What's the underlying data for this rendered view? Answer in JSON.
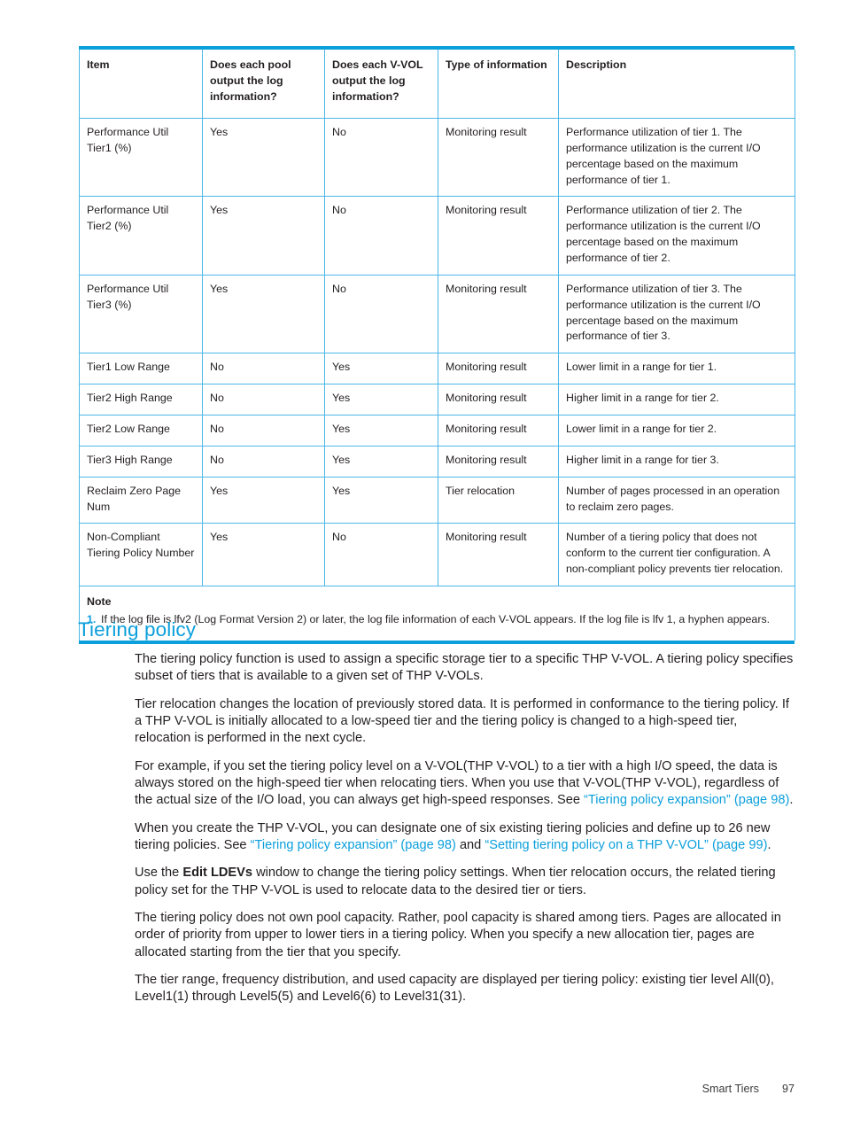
{
  "table": {
    "headers": [
      "Item",
      "Does each pool output the log information?",
      "Does each V-VOL output the log information?",
      "Type of information",
      "Description"
    ],
    "rows": [
      {
        "item": "Performance Util Tier1 (%)",
        "pool": "Yes",
        "vvol": "No",
        "type": "Monitoring result",
        "desc": "Performance utilization of tier 1. The performance utilization is the current I/O percentage based on the maximum performance of tier 1."
      },
      {
        "item": "Performance Util Tier2 (%)",
        "pool": "Yes",
        "vvol": "No",
        "type": "Monitoring result",
        "desc": "Performance utilization of tier 2. The performance utilization is the current I/O percentage based on the maximum performance of tier 2."
      },
      {
        "item": "Performance Util Tier3 (%)",
        "pool": "Yes",
        "vvol": "No",
        "type": "Monitoring result",
        "desc": "Performance utilization of tier 3. The performance utilization is the current I/O percentage based on the maximum performance of tier 3."
      },
      {
        "item": "Tier1 Low Range",
        "pool": "No",
        "vvol": "Yes",
        "type": "Monitoring result",
        "desc": "Lower limit in a range for tier 1."
      },
      {
        "item": "Tier2 High Range",
        "pool": "No",
        "vvol": "Yes",
        "type": "Monitoring result",
        "desc": "Higher limit in a range for tier 2."
      },
      {
        "item": "Tier2 Low Range",
        "pool": "No",
        "vvol": "Yes",
        "type": "Monitoring result",
        "desc": "Lower limit in a range for tier 2."
      },
      {
        "item": "Tier3 High Range",
        "pool": "No",
        "vvol": "Yes",
        "type": "Monitoring result",
        "desc": "Higher limit in a range for tier 3."
      },
      {
        "item": "Reclaim Zero Page Num",
        "pool": "Yes",
        "vvol": "Yes",
        "type": "Tier relocation",
        "desc": "Number of pages processed in an operation to reclaim zero pages."
      },
      {
        "item": "Non-Compliant Tiering Policy Number",
        "pool": "Yes",
        "vvol": "No",
        "type": "Monitoring result",
        "desc": "Number of a tiering policy that does not conform to the current tier configuration. A non-compliant policy prevents tier relocation."
      }
    ],
    "note": {
      "title": "Note",
      "number": "1.",
      "text": "If the log file is lfv2 (Log Format Version 2) or later, the log file information of each V-VOL appears. If the log file is lfv 1, a hyphen appears."
    }
  },
  "section": {
    "heading": "Tiering policy",
    "paragraphs": {
      "p1": "The tiering policy function is used to assign a specific storage tier to a specific THP V-VOL. A tiering policy specifies subset of tiers that is available to a given set of THP V-VOLs.",
      "p2": "Tier relocation changes the location of previously stored data. It is performed in conformance to the tiering policy. If a THP V-VOL is initially allocated to a low-speed tier and the tiering policy is changed to a high-speed tier, relocation is performed in the next cycle.",
      "p3_a": "For example, if you set the tiering policy level on a V-VOL(THP V-VOL) to a tier with a high I/O speed, the data is always stored on the high-speed tier when relocating tiers. When you use that V-VOL(THP V-VOL), regardless of the actual size of the I/O load, you can always get high-speed responses. See ",
      "p3_link": "“Tiering policy expansion” (page 98)",
      "p3_b": ".",
      "p4_a": "When you create the THP V-VOL, you can designate one of six existing tiering policies and define up to 26 new tiering policies. See ",
      "p4_link1": "“Tiering policy expansion” (page 98)",
      "p4_mid": " and ",
      "p4_link2": "“Setting tiering policy on a THP V-VOL” (page 99)",
      "p4_b": ".",
      "p5_a": "Use the ",
      "p5_bold": "Edit LDEVs",
      "p5_b": " window to change the tiering policy settings. When tier relocation occurs, the related tiering policy set for the THP V-VOL is used to relocate data to the desired tier or tiers.",
      "p6": "The tiering policy does not own pool capacity. Rather, pool capacity is shared among tiers. Pages are allocated in order of priority from upper to lower tiers in a tiering policy. When you specify a new allocation tier, pages are allocated starting from the tier that you specify.",
      "p7": "The tier range, frequency distribution, and used capacity are displayed per tiering policy: existing tier level All(0), Level1(1) through Level5(5) and Level6(6) to Level31(31)."
    }
  },
  "footer": {
    "chapter": "Smart Tiers",
    "page_number": "97"
  },
  "colors": {
    "accent_blue": "#0b9fdb",
    "table_border_blue": "#4db8e8",
    "text": "#231f20"
  }
}
